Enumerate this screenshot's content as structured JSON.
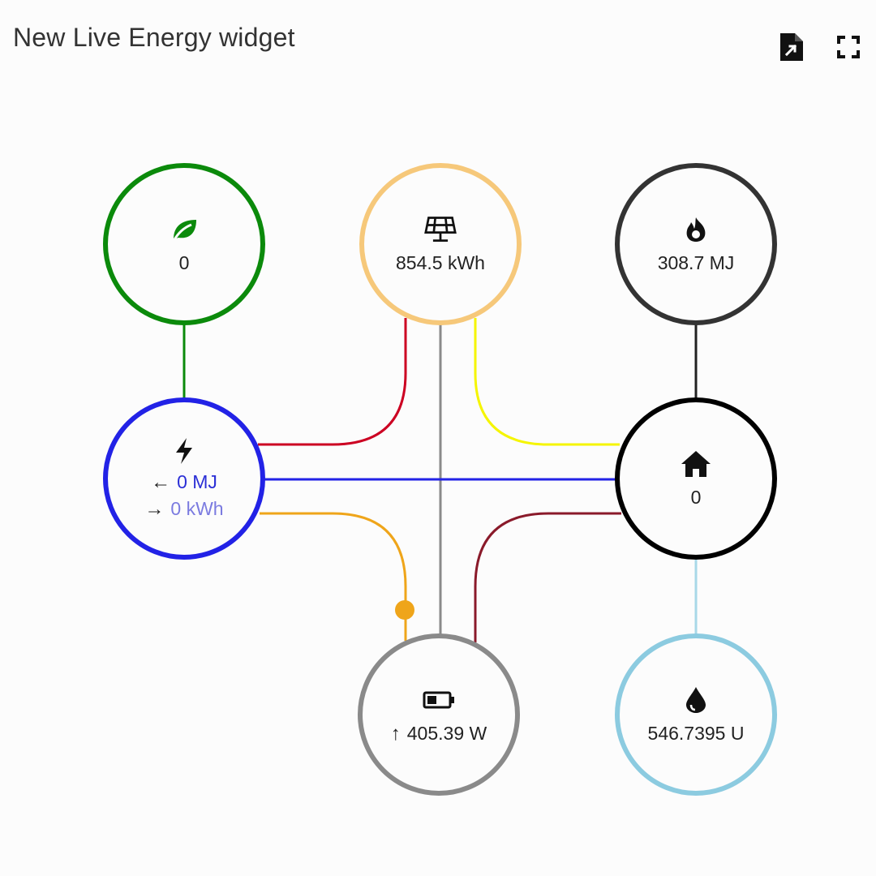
{
  "header": {
    "title": "New Live Energy widget"
  },
  "nodes": {
    "low_carbon": {
      "value": "0",
      "color": "#0b8a0b",
      "icon": "leaf-icon"
    },
    "solar": {
      "value": "854.5 kWh",
      "color": "#f6c87a",
      "icon": "solar-panel-icon"
    },
    "gas": {
      "value": "308.7 MJ",
      "color": "#333333",
      "icon": "fire-icon"
    },
    "grid": {
      "consumption": "0 MJ",
      "return": "0 kWh",
      "color": "#2222e6",
      "icon": "lightning-bolt-icon",
      "consumption_arrow": "←",
      "return_arrow": "→"
    },
    "home": {
      "value": "0",
      "color": "#000000",
      "icon": "home-icon"
    },
    "battery": {
      "value": "405.39 W",
      "arrow": "↑",
      "color": "#8a8a8a",
      "icon": "battery-low-icon"
    },
    "water": {
      "value": "546.7395 U",
      "color": "#8ccbe0",
      "icon": "water-drop-icon"
    }
  },
  "flow_colors": {
    "solar_to_grid": "#cc0022",
    "solar_to_battery": "#8a8a8a",
    "solar_to_home": "#f5f500",
    "grid_to_home": "#2222e6",
    "grid_to_battery": "#efa51a",
    "battery_to_home": "#8a1a2a",
    "low_carbon_to_grid": "#0b8a0b",
    "gas_to_home": "#222222",
    "water_to_home": "#a8d8e8"
  }
}
